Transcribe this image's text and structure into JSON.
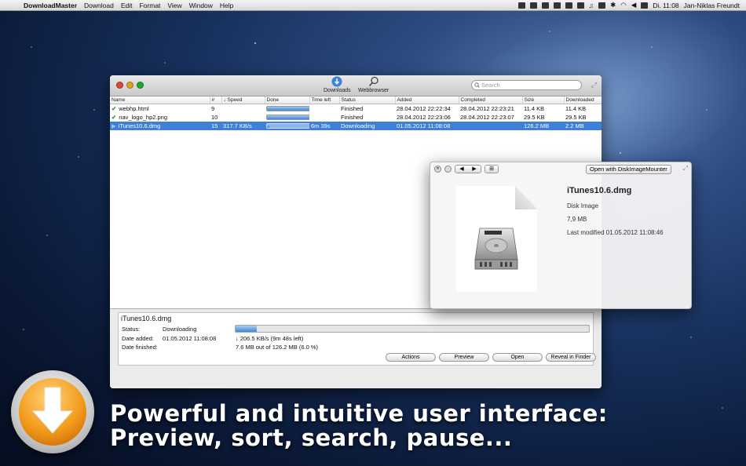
{
  "menubar": {
    "app_name": "DownloadMaster",
    "menus": [
      "Download",
      "Edit",
      "Format",
      "View",
      "Window",
      "Help"
    ],
    "clock": "Di. 11:08",
    "user": "Jan-Niklas Freundt"
  },
  "toolbar": {
    "downloads_label": "Downloads",
    "webbrowser_label": "Webbrowser",
    "search_placeholder": "Search"
  },
  "table": {
    "columns": [
      "Name",
      "#",
      "↓ Speed",
      "Done",
      "Time left",
      "Status",
      "Added",
      "Completed",
      "Size",
      "Downloaded"
    ],
    "rows": [
      {
        "name": "webhp.html",
        "num": "9",
        "speed": "",
        "progress": 1.0,
        "time_left": "",
        "status": "Finished",
        "added": "28.04.2012 22:22:34",
        "completed": "28.04.2012 22:23:21",
        "size": "11.4 KB",
        "downloaded": "11.4 KB",
        "state": "finished"
      },
      {
        "name": "nav_logo_hp2.png",
        "num": "10",
        "speed": "",
        "progress": 1.0,
        "time_left": "",
        "status": "Finished",
        "added": "28.04.2012 22:23:06",
        "completed": "28.04.2012 22:23:07",
        "size": "29.5 KB",
        "downloaded": "29.5 KB",
        "state": "finished"
      },
      {
        "name": "iTunes10.6.dmg",
        "num": "15",
        "speed": "317.7 KB/s",
        "progress": 0.06,
        "time_left": "6m 39s",
        "status": "Downloading",
        "added": "01.05.2012 11:08:08",
        "completed": "",
        "size": "126.2 MB",
        "downloaded": "2.2 MB",
        "state": "downloading"
      }
    ]
  },
  "detail": {
    "title": "iTunes10.6.dmg",
    "status_label": "Status:",
    "status_value": "Downloading",
    "date_added_label": "Date added:",
    "date_added_value": "01.05.2012 11:08:08",
    "date_finished_label": "Date finished:",
    "speed_text": "↓ 206.5 KB/s (9m 48s left)",
    "progress_text": "7.6 MB out of 126.2 MB (6.0 %)",
    "progress": 0.06,
    "buttons": {
      "actions": "Actions",
      "preview": "Preview",
      "open": "Open",
      "reveal": "Reveal in Finder"
    }
  },
  "quicklook": {
    "open_with": "Open with DiskImageMounter",
    "file_name": "iTunes10.6.dmg",
    "kind": "Disk Image",
    "size": "7,9 MB",
    "modified": "Last modified 01.05.2012 11:08:46"
  },
  "promo": {
    "line1": "Powerful and intuitive user interface:",
    "line2": "Preview, sort, search, pause..."
  },
  "colors": {
    "selection": "#3d7fd9",
    "progress": "#3f86d6",
    "accent_orange": "#f39a1a"
  }
}
